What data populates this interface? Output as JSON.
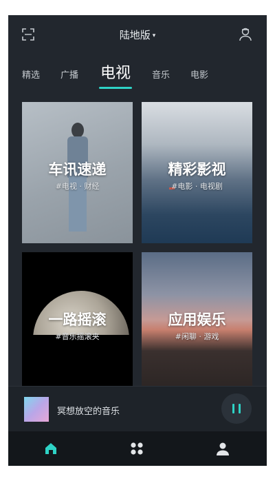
{
  "header": {
    "title": "陆地版",
    "caret": "▾"
  },
  "tabs": [
    {
      "label": "精选"
    },
    {
      "label": "广播"
    },
    {
      "label": "电视",
      "active": true
    },
    {
      "label": "音乐"
    },
    {
      "label": "电影"
    }
  ],
  "cards": [
    {
      "title": "车讯速递",
      "subtitle": "#电视 · 财经"
    },
    {
      "title": "精彩影视",
      "subtitle": "#电影 · 电视剧"
    },
    {
      "title": "一路摇滚",
      "subtitle": "#音乐摇滚夹"
    },
    {
      "title": "应用娱乐",
      "subtitle": "#闲聊 · 游戏"
    }
  ],
  "player": {
    "song": "冥想放空的音乐",
    "state": "playing"
  },
  "nav": [
    {
      "icon": "home-icon",
      "active": true
    },
    {
      "icon": "apps-grid-icon"
    },
    {
      "icon": "user-icon"
    }
  ],
  "colors": {
    "accent": "#2ed3c6",
    "background": "#22272e",
    "nav_background": "#13171b"
  }
}
